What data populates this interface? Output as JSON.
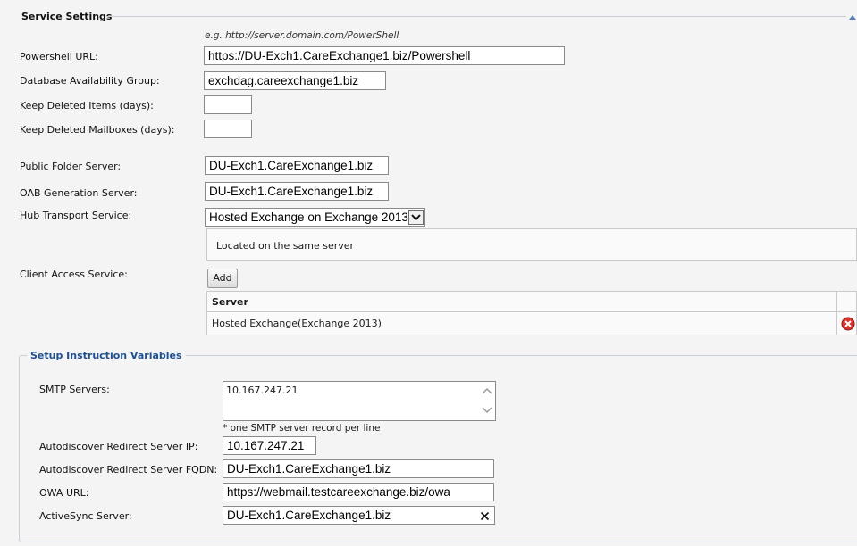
{
  "service_settings": {
    "title": "Service Settings",
    "collapse_icon": "caret-up-icon",
    "url_hint": "e.g. http://server.domain.com/PowerShell",
    "powershell_url": {
      "label": "Powershell URL:",
      "value": "https://DU-Exch1.CareExchange1.biz/Powershell"
    },
    "dag": {
      "label": "Database Availability Group:",
      "value": "exchdag.careexchange1.biz"
    },
    "keep_deleted_items": {
      "label": "Keep Deleted Items (days):",
      "value": ""
    },
    "keep_deleted_mailboxes": {
      "label": "Keep Deleted Mailboxes (days):",
      "value": ""
    },
    "public_folder_server": {
      "label": "Public Folder Server:",
      "value": "DU-Exch1.CareExchange1.biz"
    },
    "oab_generation_server": {
      "label": "OAB Generation Server:",
      "value": "DU-Exch1.CareExchange1.biz"
    },
    "hub_transport": {
      "label": "Hub Transport Service:",
      "selected": "Hosted Exchange on Exchange 2013",
      "note": "Located on the same server"
    },
    "client_access": {
      "label": "Client Access Service:",
      "add_label": "Add",
      "table_header": "Server",
      "rows": [
        {
          "server": "Hosted Exchange(Exchange 2013)"
        }
      ]
    }
  },
  "setup_instruction": {
    "title": "Setup Instruction Variables",
    "smtp_servers": {
      "label": "SMTP Servers:",
      "value": "10.167.247.21",
      "hint": "* one SMTP server record per line"
    },
    "autodiscover_ip": {
      "label": "Autodiscover Redirect Server IP:",
      "value": "10.167.247.21"
    },
    "autodiscover_fqdn": {
      "label": "Autodiscover Redirect Server FQDN:",
      "value": "DU-Exch1.CareExchange1.biz"
    },
    "owa_url": {
      "label": "OWA URL:",
      "value": "https://webmail.testcareexchange.biz/owa"
    },
    "activesync": {
      "label": "ActiveSync Server:",
      "value": "DU-Exch1.CareExchange1.biz"
    }
  },
  "colors": {
    "accent": "#1f4f8f",
    "delete": "#d9342b",
    "background": "#f4f4f4"
  }
}
